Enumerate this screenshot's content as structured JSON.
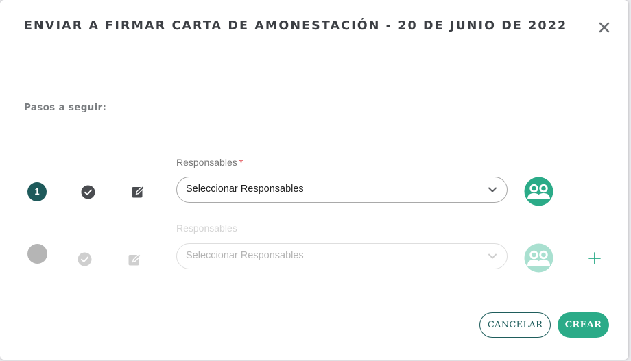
{
  "dialog": {
    "title": "ENVIAR A FIRMAR CARTA DE AMONESTACIÓN - 20 DE JUNIO DE 2022",
    "steps_label": "Pasos a seguir:"
  },
  "steps": [
    {
      "number": "1",
      "field_label": "Responsables",
      "required_mark": "*",
      "select_value": "Seleccionar Responsables"
    },
    {
      "field_label": "Responsables",
      "select_value": "Seleccionar Responsables"
    }
  ],
  "actions": {
    "cancel_label": "CANCELAR",
    "create_label": "CREAR"
  },
  "colors": {
    "accent": "#2bab88",
    "accent_dark": "#1e5a5b",
    "accent_light": "#a9e0d0",
    "required": "#e0444a"
  },
  "icons": {
    "close": "close-icon",
    "check": "check-circle-icon",
    "edit": "edit-sign-icon",
    "group": "user-group-icon",
    "chevron": "chevron-down-icon",
    "add": "plus-icon"
  }
}
